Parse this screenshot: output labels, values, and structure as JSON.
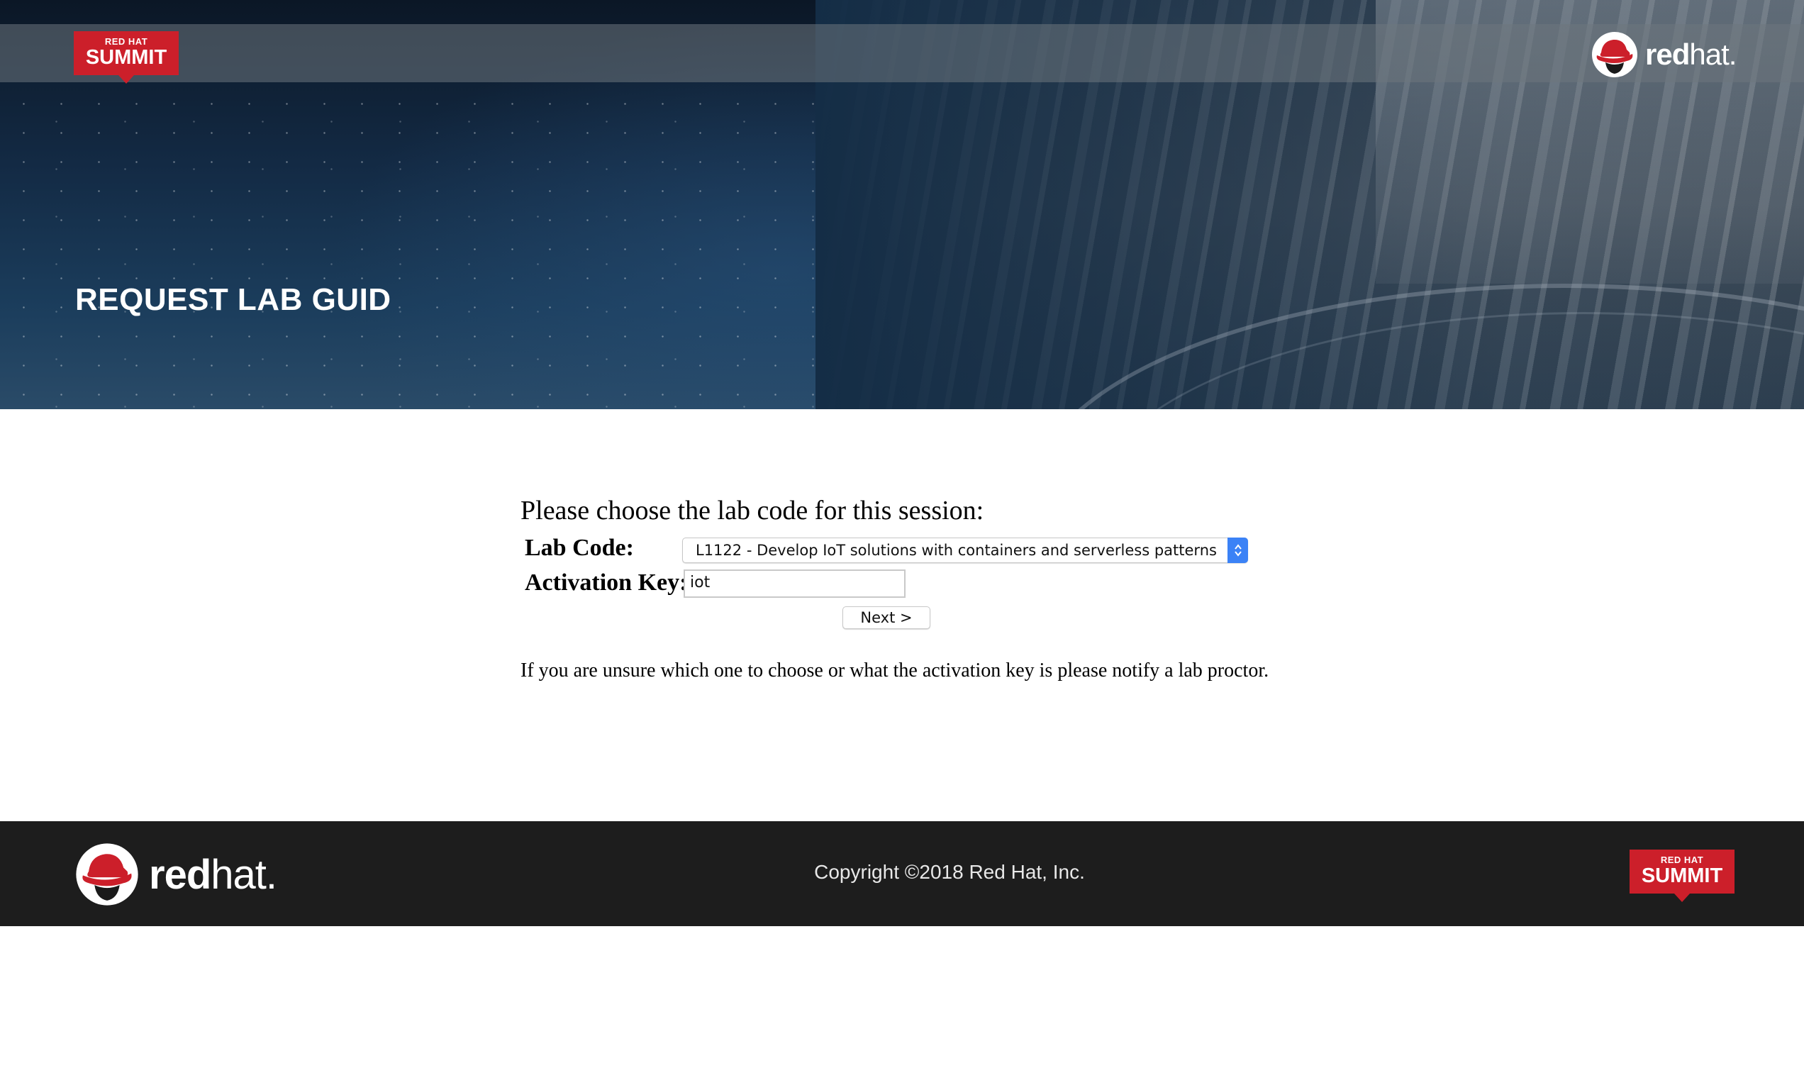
{
  "header": {
    "summit_badge": {
      "top": "RED HAT",
      "bottom": "SUMMIT"
    },
    "redhat_logo": {
      "bold": "red",
      "light": "hat",
      "suffix": "."
    },
    "title": "REQUEST LAB GUID"
  },
  "form": {
    "prompt": "Please choose the lab code for this session:",
    "lab_code_label": "Lab Code:",
    "lab_code_value": "L1122 - Develop IoT solutions with containers and serverless patterns",
    "activation_key_label": "Activation Key:",
    "activation_key_value": "iot",
    "next_label": "Next >",
    "note": "If you are unsure which one to choose or what the activation key is please notify a lab proctor."
  },
  "footer": {
    "redhat_logo": {
      "bold": "red",
      "light": "hat",
      "suffix": "."
    },
    "copyright": "Copyright ©2018 Red Hat, Inc.",
    "summit_badge": {
      "top": "RED HAT",
      "bottom": "SUMMIT"
    }
  },
  "colors": {
    "brand_red": "#cc1f2a",
    "footer_bg": "#1d1d1d",
    "select_accent": "#3b82f6"
  }
}
